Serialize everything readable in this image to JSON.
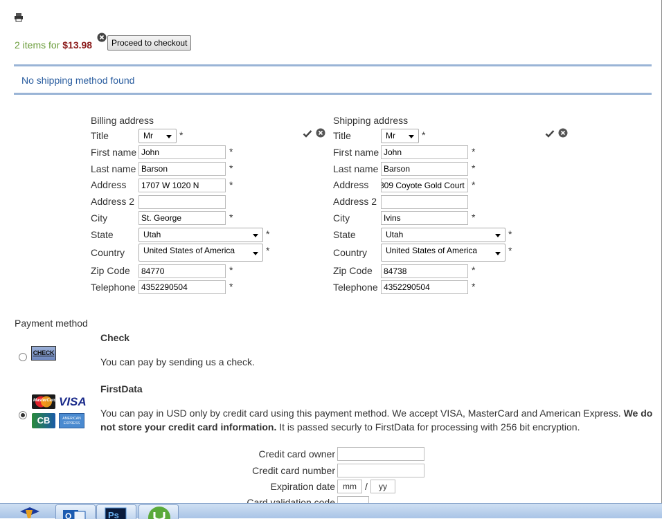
{
  "cart": {
    "count_text": "2 items for",
    "price": "$13.98",
    "checkout_label": "Proceed to checkout"
  },
  "shipping_message": "No shipping method found",
  "billing": {
    "heading": "Billing address",
    "labels": {
      "title": "Title",
      "first_name": "First name",
      "last_name": "Last name",
      "address": "Address",
      "address2": "Address 2",
      "city": "City",
      "state": "State",
      "country": "Country",
      "zip": "Zip Code",
      "telephone": "Telephone"
    },
    "values": {
      "title": "Mr",
      "first_name": "John",
      "last_name": "Barson",
      "address": "1707 W 1020 N",
      "address2": "",
      "city": "St. George",
      "state": "Utah",
      "country": "United States of America",
      "zip": "84770",
      "telephone": "4352290504"
    }
  },
  "shipping": {
    "heading": "Shipping address",
    "labels": {
      "title": "Title",
      "first_name": "First name",
      "last_name": "Last name",
      "address": "Address",
      "address2": "Address 2",
      "city": "City",
      "state": "State",
      "country": "Country",
      "zip": "Zip Code",
      "telephone": "Telephone"
    },
    "values": {
      "title": "Mr",
      "first_name": "John",
      "last_name": "Barson",
      "address": "309 Coyote Gold Court",
      "address2": "",
      "city": "Ivins",
      "state": "Utah",
      "country": "United States of America",
      "zip": "84738",
      "telephone": "4352290504"
    }
  },
  "required_mark": "*",
  "payment": {
    "heading": "Payment method",
    "check": {
      "title": "Check",
      "logo_text": "CHECK",
      "description": "You can pay by sending us a check."
    },
    "firstdata": {
      "title": "FirstData",
      "desc_part1": "You can pay in USD only by credit card using this payment method. We accept VISA, MasterCard and American Express.",
      "desc_bold": "We do not store your credit card information.",
      "desc_part2": "It is passed securly to FirstData for processing with 256 bit encryption.",
      "logos": [
        "MasterCard",
        "VISA",
        "CB",
        "AMERICAN EXPRESS"
      ]
    },
    "card_form": {
      "owner_label": "Credit card owner",
      "number_label": "Credit card number",
      "expiration_label": "Expiration date",
      "exp_month_placeholder": "mm",
      "exp_separator": "/",
      "exp_year_placeholder": "yy",
      "cvv_label": "Card validation code"
    }
  },
  "colors": {
    "cart_count": "#6a9c3a",
    "cart_price": "#8b1a1a",
    "shipping_border": "#9ab4d6",
    "shipping_text": "#2a5d9f"
  },
  "taskbar": {
    "apps": [
      "start-icon",
      "outlook-icon",
      "photoshop-icon",
      "utorrent-icon"
    ]
  }
}
